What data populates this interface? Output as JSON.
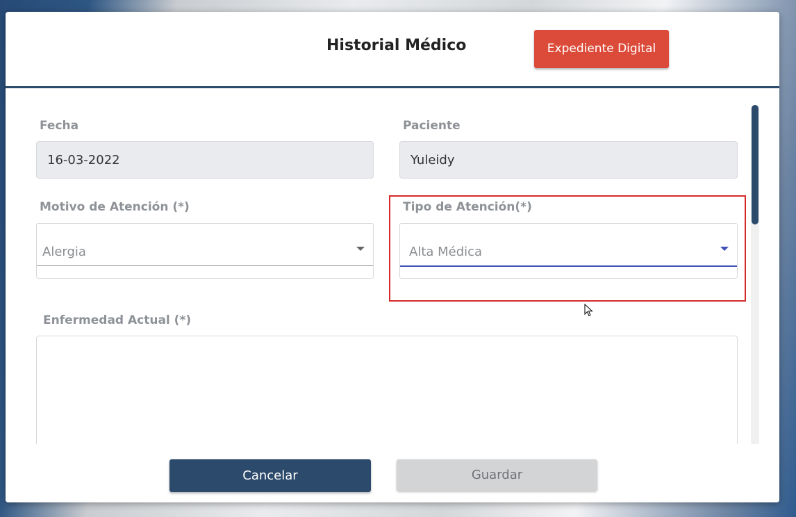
{
  "header": {
    "title": "Historial Médico",
    "digital_button": "Expediente Digital"
  },
  "form": {
    "fecha": {
      "label": "Fecha",
      "value": "16-03-2022"
    },
    "paciente": {
      "label": "Paciente",
      "value": "Yuleidy"
    },
    "motivo": {
      "label": "Motivo de Atención (*)",
      "value": "Alergia"
    },
    "tipo": {
      "label": "Tipo de Atención(*)",
      "value": "Alta Médica"
    },
    "enfermedad": {
      "label": "Enfermedad Actual (*)",
      "value": ""
    }
  },
  "footer": {
    "cancel": "Cancelar",
    "save": "Guardar"
  },
  "colors": {
    "primary": "#2c4a6b",
    "danger": "#dc4b39",
    "focus": "#3f51b5",
    "highlight": "#d62a2a"
  }
}
